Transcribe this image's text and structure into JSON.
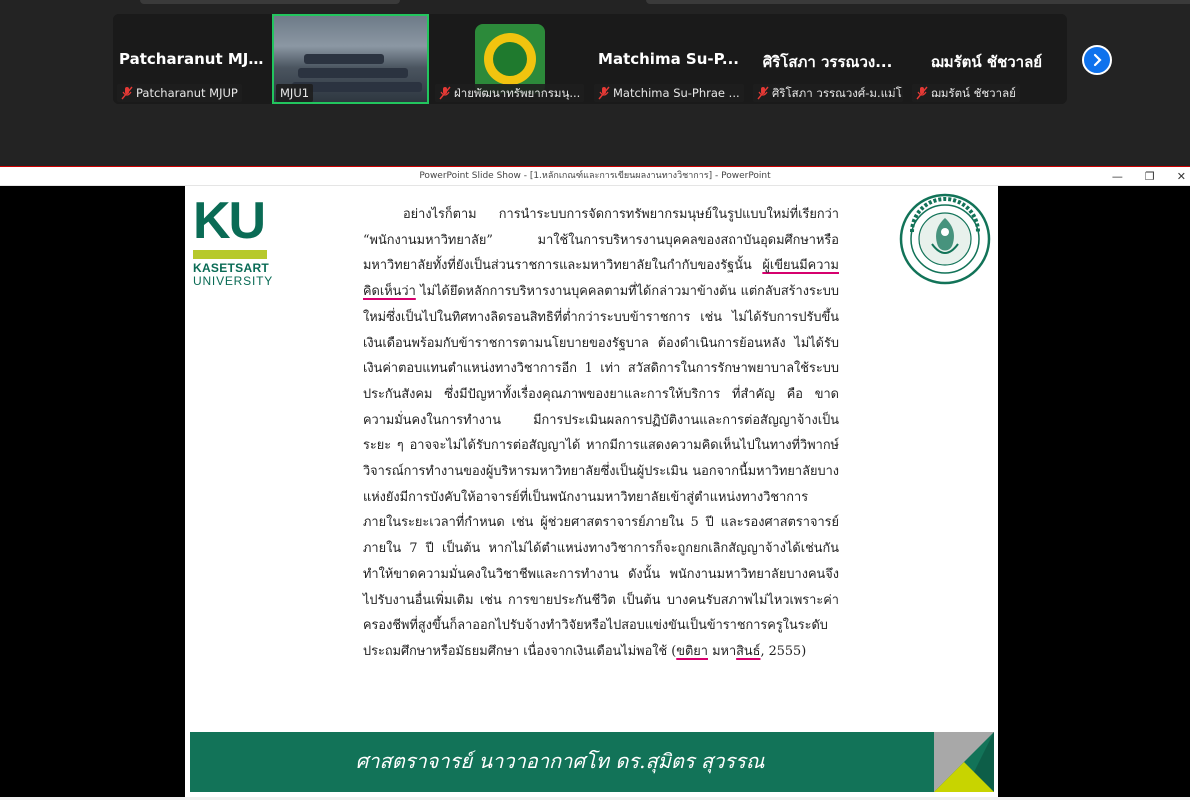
{
  "participants": [
    {
      "big_name": "Patcharanut  MJ...",
      "label": "Patcharanut MJUP",
      "muted": true,
      "type": "name"
    },
    {
      "big_name": "",
      "label": "MJU1",
      "muted": false,
      "type": "video",
      "active": true
    },
    {
      "big_name": "",
      "label": "ฝ่ายพัฒนาทรัพยากรมนุ...",
      "muted": true,
      "type": "logo"
    },
    {
      "big_name": "Matchima  Su-P...",
      "label": "Matchima Su-Phrae ...",
      "muted": true,
      "type": "name"
    },
    {
      "big_name": "ศิริโสภา วรรณวง...",
      "label": "ศิริโสภา วรรณวงศ์-ม.แม่โ...",
      "muted": true,
      "type": "name"
    },
    {
      "big_name": "ฌมรัตน์ ชัชวาลย์",
      "label": "ฌมรัตน์ ชัชวาลย์",
      "muted": true,
      "type": "name"
    }
  ],
  "ppt": {
    "window_title": "PowerPoint Slide Show - [1.หลักเกณฑ์และการเขียนผลงานทางวิชาการ] - PowerPoint",
    "min": "—",
    "restore": "❐",
    "close": "✕"
  },
  "slide": {
    "logo": {
      "big": "KU",
      "line1": "KASETSART",
      "line2": "UNIVERSITY"
    },
    "text_before_ul1": "อย่างไรก็ตาม การนำระบบการจัดการทรัพยากรมนุษย์ในรูปแบบใหม่ที่เรียกว่า “พนักงานมหาวิทยาลัย” มาใช้ในการบริหารงานบุคคลของสถาบันอุดมศึกษาหรือมหาวิทยาลัยทั้งที่ยังเป็นส่วนราชการและมหาวิทยาลัยในกำกับของรัฐนั้น ",
    "ul1": "ผู้เขียนมีความคิดเห็นว่า",
    "text_middle": " ไม่ได้ยึดหลักการบริหารงานบุคคลตามที่ได้กล่าวมาข้างต้น แต่กลับสร้างระบบใหม่ซึ่งเป็นไปในทิศทางลิดรอนสิทธิที่ต่ำกว่าระบบข้าราชการ เช่น ไม่ได้รับการปรับขึ้นเงินเดือนพร้อมกับข้าราชการตามนโยบายของรัฐบาล ต้องดำเนินการย้อนหลัง ไม่ได้รับเงินค่าตอบแทนตำแหน่งทางวิชาการอีก 1 เท่า สวัสดิการในการรักษาพยาบาลใช้ระบบประกันสังคม ซึ่งมีปัญหาทั้งเรื่องคุณภาพของยาและการให้บริการ ที่สำคัญ คือ ขาดความมั่นคงในการทำงาน มีการประเมินผลการปฏิบัติงานและการต่อสัญญาจ้างเป็นระยะ ๆ อาจจะไม่ได้รับการต่อสัญญาได้ หากมีการแสดงความคิดเห็นไปในทางที่วิพากษ์วิจารณ์การทำงานของผู้บริหารมหาวิทยาลัยซึ่งเป็นผู้ประเมิน นอกจากนี้มหาวิทยาลัยบางแห่งยังมีการบังคับให้อาจารย์ที่เป็นพนักงานมหาวิทยาลัยเข้าสู่ตำแหน่งทางวิชาการภายในระยะเวลาที่กำหนด เช่น ผู้ช่วยศาสตราจารย์ภายใน 5 ปี และรองศาสตราจารย์ ภายใน 7 ปี เป็นต้น หากไม่ได้ตำแหน่งทางวิชาการก็จะถูกยกเลิกสัญญาจ้างได้เช่นกัน ทำให้ขาดความมั่นคงในวิชาชีพและการทำงาน ดังนั้น พนักงานมหาวิทยาลัยบางคนจึงไปรับงานอื่นเพิ่มเติม เช่น การขายประกันชีวิต เป็นต้น บางคนรับสภาพไม่ไหวเพราะค่าครองชีพที่สูงขึ้นก็ลาออกไปรับจ้างทำวิจัยหรือไปสอบแข่งขันเป็นข้าราชการครูในระดับประถมศึกษาหรือมัธยมศึกษา เนื่องจากเงินเดือนไม่พอใช้ (",
    "ul2": "ขติยา",
    "text_between": " มหา",
    "ul3": "สินธ์",
    "text_end": ", 2555)",
    "footer": "ศาสตราจารย์ นาวาอากาศโท ดร.สุมิตร สุวรรณ"
  },
  "colors": {
    "ku_green": "#0a6b55",
    "ku_lime": "#b7c92b",
    "footer_green": "#127358",
    "active_outline": "#22c55e",
    "zoom_blue": "#0e72ed",
    "underline": "#d6006e"
  }
}
